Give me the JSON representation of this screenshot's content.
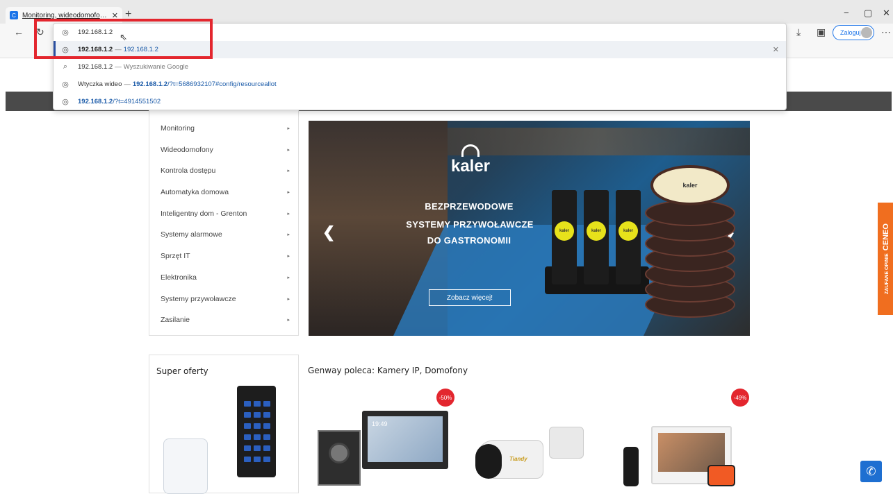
{
  "browser": {
    "tab_title": "Monitoring, wideodomofony, do",
    "tab_favicon": "C",
    "tab_close": "✕",
    "new_tab": "+",
    "window_controls": [
      "−",
      "▢",
      "✕"
    ],
    "back_icon": "←",
    "reload_icon": "↻",
    "download_icon": "⤓",
    "collections_icon": "▣",
    "login_label": "Zaloguj",
    "more_icon": "⋯"
  },
  "omnibox": {
    "input_value": "192.168.1.2",
    "suggestions": [
      {
        "bold": "192.168.1.2",
        "separator": "—",
        "url": "192.168.1.2",
        "url_bold": "",
        "icon": "globe-icon"
      },
      {
        "text": "192.168.1.2",
        "separator": "—",
        "suffix": "Wyszukiwanie Google",
        "icon": "search-icon"
      },
      {
        "prefix": "Wtyczka wideo",
        "separator": "—",
        "url_bold": "192.168.1.2",
        "url_rest": "/?t=5686932107#config/resourceallot",
        "icon": "globe-icon"
      },
      {
        "url_bold": "192.168.1.2",
        "url_rest": "/?t=4914551502",
        "icon": "globe-icon"
      }
    ],
    "remove_icon": "✕"
  },
  "menu": {
    "items": [
      "Monitoring",
      "Wideodomofony",
      "Kontrola dostępu",
      "Automatyka domowa",
      "Inteligentny dom - Grenton",
      "Systemy alarmowe",
      "Sprzęt IT",
      "Elektronika",
      "Systemy przywoławcze",
      "Zasilanie"
    ],
    "arrow": "▸"
  },
  "banner": {
    "logo": "kaler",
    "line1": "BEZPRZEWODOWE",
    "line2": "SYSTEMY PRZYWOŁAWCZE",
    "line3": "DO GASTRONOMII",
    "button": "Zobacz więcej!",
    "prev": "❮",
    "next": "❯",
    "pager_label": "kaler"
  },
  "ceneo": {
    "sub": "ZAUFANE OPINIE",
    "brand": "CENEO"
  },
  "offers": {
    "super_title": "Super oferty",
    "genway_title": "Genway poleca: Kamery IP, Domofony",
    "discount1": "-50%",
    "discount2": "-49%",
    "monitor_time": "19:49",
    "camera_brand": "Tiandy"
  },
  "call_icon": "✆"
}
